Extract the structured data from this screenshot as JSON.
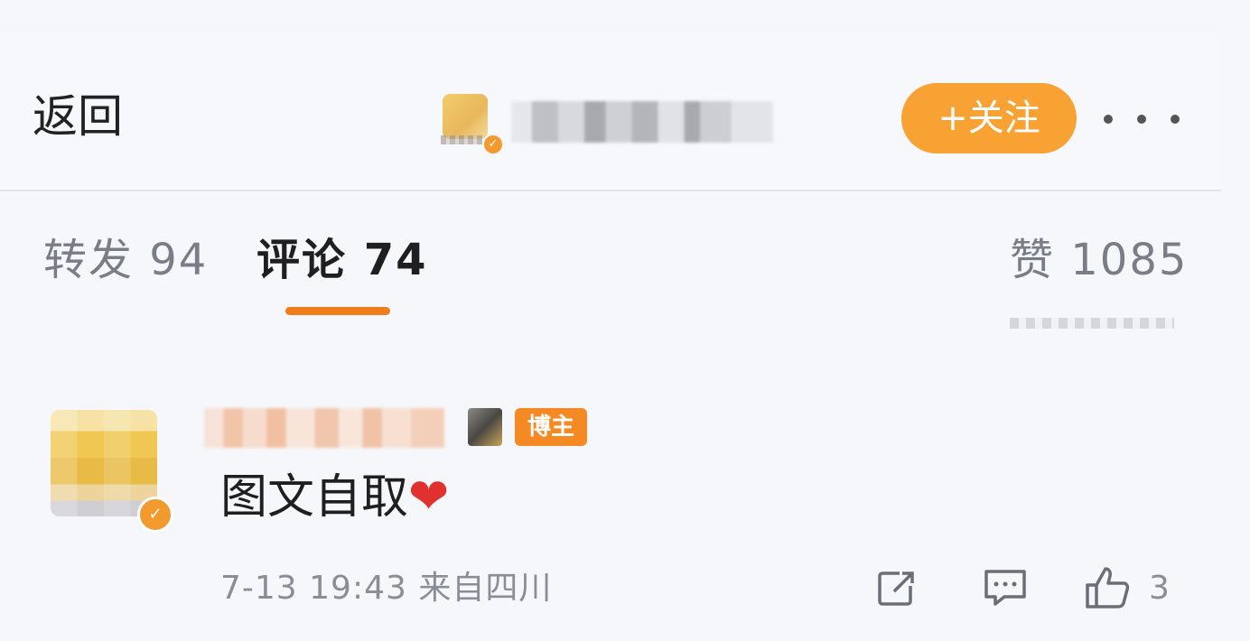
{
  "header": {
    "back_label": "返回",
    "follow_label": "+关注"
  },
  "tabs": {
    "forward": "转发 94",
    "comment": "评论 74",
    "like": "赞 1085"
  },
  "comment": {
    "author_badge": "博主",
    "text": "图文自取",
    "heart": "❤",
    "meta": "7-13 19:43 来自四川",
    "like_count": "3"
  },
  "colors": {
    "accent": "#f8a233",
    "tab_underline": "#f07c1c",
    "badge": "#f58a24",
    "heart": "#e0312e"
  }
}
